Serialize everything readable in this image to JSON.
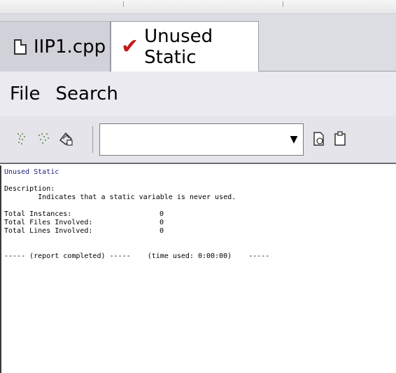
{
  "tabs": [
    {
      "label": "IIP1.cpp",
      "icon": "file-icon"
    },
    {
      "label": "Unused Static",
      "icon": "check-icon",
      "active": true
    }
  ],
  "menu": [
    "File",
    "Search"
  ],
  "toolbar": {
    "search_value": "",
    "icons": [
      "find-icon",
      "find-all-icon",
      "select-tool-icon",
      "copy-icon",
      "paste-icon"
    ]
  },
  "report": {
    "title": "Unused Static",
    "description_label": "Description:",
    "description_text": "        Indicates that a static variable is never used.",
    "stats": [
      {
        "label": "Total Instances:",
        "value": "0"
      },
      {
        "label": "Total Files Involved:",
        "value": "0"
      },
      {
        "label": "Total Lines Involved:",
        "value": "0"
      }
    ],
    "footer": "----- (report completed) -----    (time used: 0:00:00)    -----"
  },
  "colors": {
    "check_icon": "#c41818",
    "title_text": "#1a1a7a"
  }
}
